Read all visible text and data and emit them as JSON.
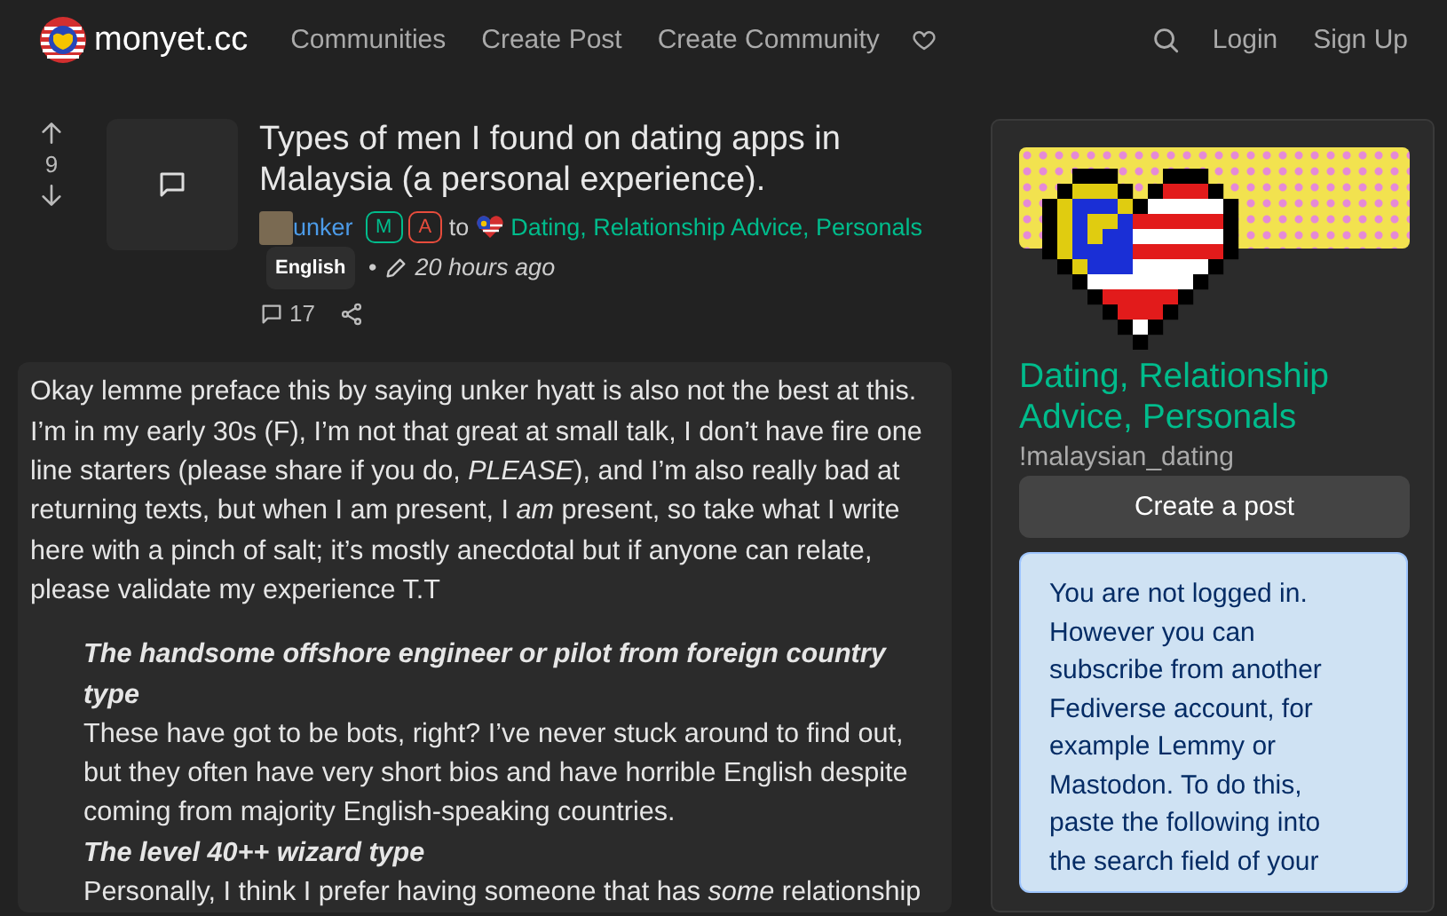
{
  "navbar": {
    "site_name": "monyet.cc",
    "links": [
      "Communities",
      "Create Post",
      "Create Community"
    ],
    "login": "Login",
    "signup": "Sign Up"
  },
  "post": {
    "score": "9",
    "title": "Types of men I found on dating apps in Malaysia (a personal experience).",
    "author": "unker",
    "badges": [
      {
        "label": "M",
        "color": "#00bc8c"
      },
      {
        "label": "A",
        "color": "#e74c3c"
      }
    ],
    "to": "to",
    "community": "Dating, Relationship Advice, Personals",
    "language": "English",
    "separator": "•",
    "time": "20 hours ago",
    "comment_count": "17"
  },
  "body": {
    "intro": "Okay lemme preface this by saying unker hyatt is also not the best at this. I’m in my early 30s (F), I’m not that great at small talk, I don’t have fire one line starters (please share if you do, *PLEASE*), and I’m also really bad at returning texts, but when I am present, I *am* present, so take what I write here with a pinch of salt; it’s mostly anecdotal but if anyone can relate, please validate my experience T.T",
    "sections": [
      {
        "kind": "heading",
        "text": "The handsome offshore engineer or pilot from foreign country type"
      },
      {
        "kind": "text",
        "text": "These have got to be bots, right? I’ve never stuck around to find out, but they often have very short bios and have horrible English despite coming from majority English-speaking countries."
      },
      {
        "kind": "heading",
        "text": "The level 40++ wizard type"
      },
      {
        "kind": "text",
        "text": "Personally, I think I prefer having someone that has *some* relationship"
      }
    ]
  },
  "sidebar": {
    "community_title": "Dating, Relationship Advice, Personals",
    "community_name": "!malaysian_dating",
    "create_button": "Create a post",
    "notice": "You are not logged in. However you can subscribe from another Fediverse account, for example Lemmy or Mastodon. To do this, paste the following into the search field of your"
  }
}
